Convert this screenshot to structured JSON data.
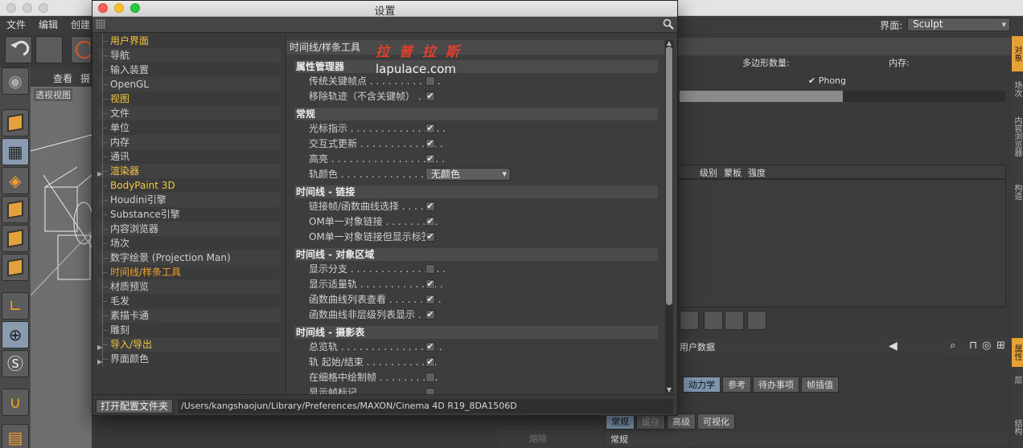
{
  "app": {
    "menu": [
      "文件",
      "编辑",
      "创建"
    ],
    "layout_label": "界面:",
    "layout_value": "Sculpt",
    "viewport_menu": [
      "查看",
      "摄"
    ],
    "viewport_label": "透视视图",
    "right_panel": {
      "poly_count_label": "多边形数量:",
      "memory_label": "内存:",
      "phong_label": "Phong",
      "progress_fraction": 0.5,
      "table_headers": [
        "级别",
        "蒙板",
        "强度"
      ],
      "attr_label": "用户数据",
      "tabs": [
        "动力学",
        "参考",
        "待办事项",
        "帧插值"
      ],
      "tabs2": [
        "常规",
        "缓存",
        "高级",
        "可视化"
      ],
      "section": "常规",
      "side_tabs": [
        "对象",
        "场次",
        "内容浏览器",
        "构造",
        "属性",
        "层",
        "结构"
      ]
    },
    "bottom_left": "熔除"
  },
  "dialog": {
    "title": "设置",
    "nav": [
      {
        "label": "用户界面",
        "bold": true
      },
      {
        "label": "导航"
      },
      {
        "label": "输入装置"
      },
      {
        "label": "OpenGL"
      },
      {
        "label": "视图",
        "bold": true
      },
      {
        "label": "文件"
      },
      {
        "label": "单位"
      },
      {
        "label": "内存"
      },
      {
        "label": "通讯"
      },
      {
        "label": "渲染器",
        "bold": true,
        "expandable": true
      },
      {
        "label": "BodyPaint 3D",
        "bold": true
      },
      {
        "label": "Houdini引擎"
      },
      {
        "label": "Substance引擎"
      },
      {
        "label": "内容浏览器"
      },
      {
        "label": "场次"
      },
      {
        "label": "数字绘景 (Projection Man)"
      },
      {
        "label": "时间线/样条工具",
        "selected": true
      },
      {
        "label": "材质预览"
      },
      {
        "label": "毛发"
      },
      {
        "label": "素描卡通"
      },
      {
        "label": "雕刻"
      },
      {
        "label": "导入/导出",
        "bold": true,
        "expandable": true
      },
      {
        "label": "界面颜色",
        "expandable": true
      }
    ],
    "pane_title": "时间线/样条工具",
    "groups": [
      {
        "title": "属性管理器",
        "options": [
          {
            "label": "传统关键帧点 . . . . . . . . . . . .",
            "checked": false
          },
          {
            "label": "移除轨迹（不含关键帧） . . .",
            "checked": true
          }
        ]
      },
      {
        "title": "常规",
        "options": [
          {
            "label": "光标指示 . . . . . . . . . . . . . . . .",
            "checked": true
          },
          {
            "label": "交互式更新 . . . . . . . . . . . . . .",
            "checked": true
          },
          {
            "label": "高亮 . . . . . . . . . . . . . . . . . . .",
            "checked": true
          },
          {
            "label": "轨颜色 . . . . . . . . . . . . . . . . .",
            "dropdown": "无颜色"
          }
        ]
      },
      {
        "title": "时间线 - 链接",
        "options": [
          {
            "label": "链接帧/函数曲线选择 . . . . . .",
            "checked": true
          },
          {
            "label": "OM单一对象链接 . . . . . . . . .",
            "checked": true
          },
          {
            "label": "OM单一对象链接但显示标签",
            "checked": true
          }
        ]
      },
      {
        "title": "时间线 - 对象区域",
        "options": [
          {
            "label": "显示分支 . . . . . . . . . . . . . . . .",
            "checked": false
          },
          {
            "label": "显示适量轨 . . . . . . . . . . . . . .",
            "checked": true
          },
          {
            "label": "函数曲线列表查看 . . . . . . . . .",
            "checked": true
          },
          {
            "label": "函数曲线非层级列表显示 . . .",
            "checked": true
          }
        ]
      },
      {
        "title": "时间线 - 摄影表",
        "options": [
          {
            "label": "总览轨 . . . . . . . . . . . . . . . . .",
            "checked": true
          },
          {
            "label": "轨 起始/结束 . . . . . . . . . . . .",
            "checked": true
          },
          {
            "label": "在细格中绘制帧 . . . . . . . . . .",
            "checked": false
          },
          {
            "label": "显示帧标记 . . . . . . . . . . . . . .",
            "checked": false
          }
        ]
      }
    ],
    "watermark_cn": "拉 普 拉 斯",
    "watermark_url": "lapulace.com",
    "open_folder_button": "打开配置文件夹",
    "path": "/Users/kangshaojun/Library/Preferences/MAXON/Cinema 4D R19_8DA1506D"
  }
}
